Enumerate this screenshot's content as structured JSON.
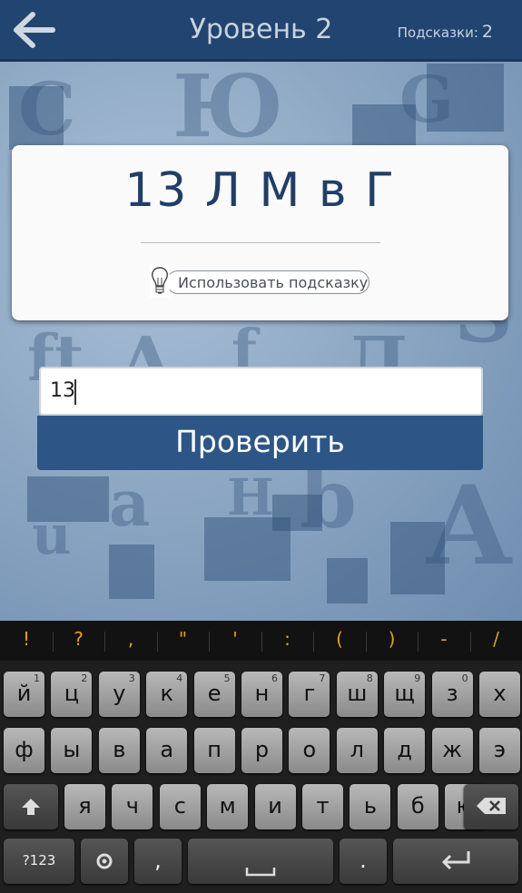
{
  "header": {
    "title": "Уровень 2",
    "hints_label": "Подсказки:",
    "hints_count": "2"
  },
  "puzzle": {
    "text": "13 Л М в Г",
    "hint_button_label": "Использовать подсказку"
  },
  "answer": {
    "value": "13"
  },
  "check_button_label": "Проверить",
  "keyboard": {
    "symbols": [
      "!",
      "?",
      ",",
      "\"",
      "'",
      ":",
      "(",
      ")",
      "-",
      "/"
    ],
    "row1": [
      {
        "k": "й",
        "n": "1"
      },
      {
        "k": "ц",
        "n": "2"
      },
      {
        "k": "у",
        "n": "3"
      },
      {
        "k": "к",
        "n": "4"
      },
      {
        "k": "е",
        "n": "5"
      },
      {
        "k": "н",
        "n": "6"
      },
      {
        "k": "г",
        "n": "7"
      },
      {
        "k": "ш",
        "n": "8"
      },
      {
        "k": "щ",
        "n": "9"
      },
      {
        "k": "з",
        "n": "0"
      },
      {
        "k": "х",
        "n": ""
      }
    ],
    "row2": [
      "ф",
      "ы",
      "в",
      "а",
      "п",
      "р",
      "о",
      "л",
      "д",
      "ж",
      "э"
    ],
    "row3": [
      "я",
      "ч",
      "с",
      "м",
      "и",
      "т",
      "ь",
      "б",
      "ю"
    ],
    "mode_key": "?123",
    "comma_key": ",",
    "period_key": "."
  }
}
